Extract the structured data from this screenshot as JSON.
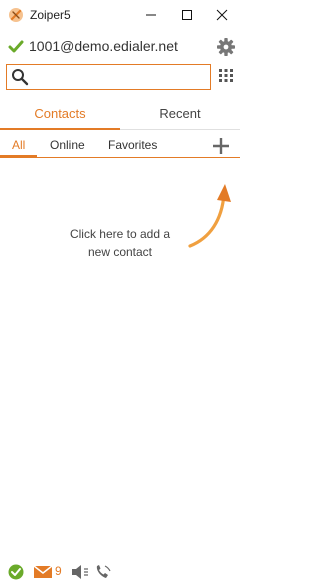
{
  "window": {
    "title": "Zoiper5"
  },
  "account": {
    "name": "1001@demo.edialer.net",
    "status": "online"
  },
  "search": {
    "value": "",
    "placeholder": ""
  },
  "tabs": [
    {
      "label": "Contacts",
      "active": true
    },
    {
      "label": "Recent",
      "active": false
    }
  ],
  "filters": [
    {
      "label": "All",
      "active": true
    },
    {
      "label": "Online",
      "active": false
    },
    {
      "label": "Favorites",
      "active": false
    }
  ],
  "empty_hint": "Click here to add a\nnew contact",
  "statusbar": {
    "unread_count": "9"
  },
  "colors": {
    "accent": "#e37b26",
    "online": "#6aaa2a",
    "icon_gray": "#666666"
  },
  "icons": [
    "zoiper-logo-icon",
    "minimize-icon",
    "maximize-icon",
    "close-icon",
    "check-icon",
    "gear-icon",
    "search-icon",
    "dialpad-icon",
    "plus-icon",
    "curved-arrow-icon",
    "mail-icon",
    "speaker-icon",
    "phone-icon"
  ]
}
